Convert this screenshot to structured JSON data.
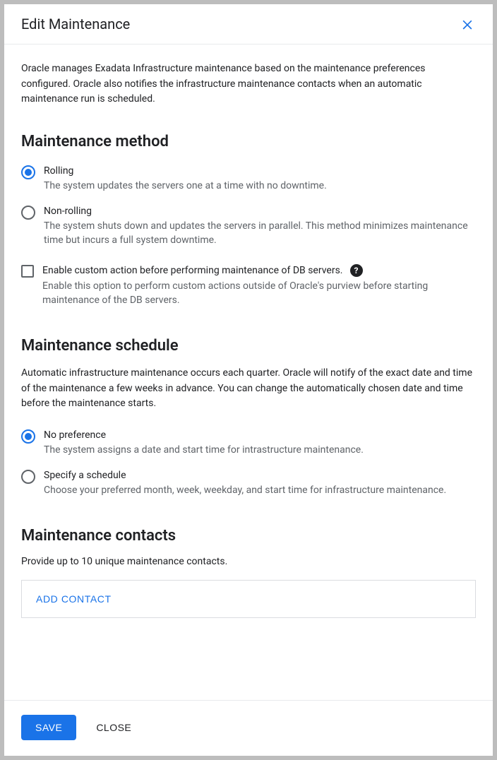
{
  "header": {
    "title": "Edit Maintenance"
  },
  "intro": "Oracle manages Exadata Infrastructure maintenance based on the maintenance preferences configured. Oracle also notifies the infrastructure maintenance contacts when an automatic maintenance run is scheduled.",
  "method": {
    "heading": "Maintenance method",
    "rolling": {
      "label": "Rolling",
      "desc": "The system updates the servers one at a time with no downtime."
    },
    "nonrolling": {
      "label": "Non-rolling",
      "desc": "The system shuts down and updates the servers in parallel. This method minimizes maintenance time but incurs a full system downtime."
    },
    "customAction": {
      "label": "Enable custom action before performing maintenance of DB servers.",
      "desc": "Enable this option to perform custom actions outside of Oracle's purview before starting maintenance of the DB servers."
    }
  },
  "schedule": {
    "heading": "Maintenance schedule",
    "intro": "Automatic infrastructure maintenance occurs each quarter. Oracle will notify of the exact date and time of the maintenance a few weeks in advance. You can change the automatically chosen date and time before the maintenance starts.",
    "noPref": {
      "label": "No preference",
      "desc": "The system assigns a date and start time for intrastructure maintenance."
    },
    "specify": {
      "label": "Specify a schedule",
      "desc": "Choose your preferred month, week, weekday, and start time for infrastructure maintenance."
    }
  },
  "contacts": {
    "heading": "Maintenance contacts",
    "intro": "Provide up to 10 unique maintenance contacts.",
    "addLabel": "ADD CONTACT"
  },
  "footer": {
    "save": "SAVE",
    "close": "CLOSE"
  }
}
